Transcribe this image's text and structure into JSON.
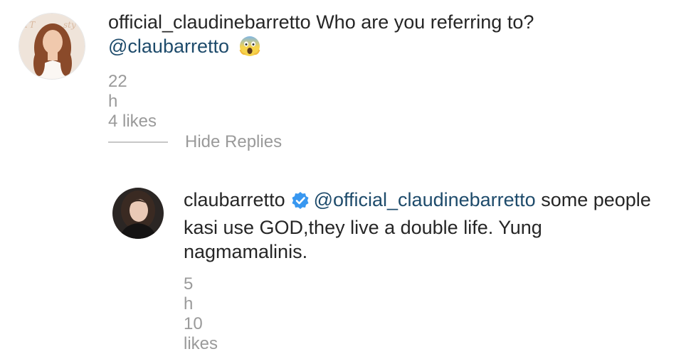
{
  "comments": [
    {
      "username": "official_claudinebarretto",
      "text": "Who are you referring to?",
      "mention": "@claubarretto",
      "emoji_icon": "face-screaming-in-fear-icon",
      "time": "22 h",
      "likes": "4 likes"
    }
  ],
  "replies_toggle": {
    "label": "Hide Replies"
  },
  "replies": [
    {
      "username": "claubarretto",
      "verified_icon": "verified-badge-icon",
      "mention": "@official_claudinebarretto",
      "text": "some people kasi use GOD,they live a double life. Yung nagmamalinis.",
      "time": "5 h",
      "likes": "10 likes"
    }
  ],
  "colors": {
    "mention": "#1e4b6b",
    "meta": "#9a9a9a",
    "verified": "#3897f0"
  }
}
